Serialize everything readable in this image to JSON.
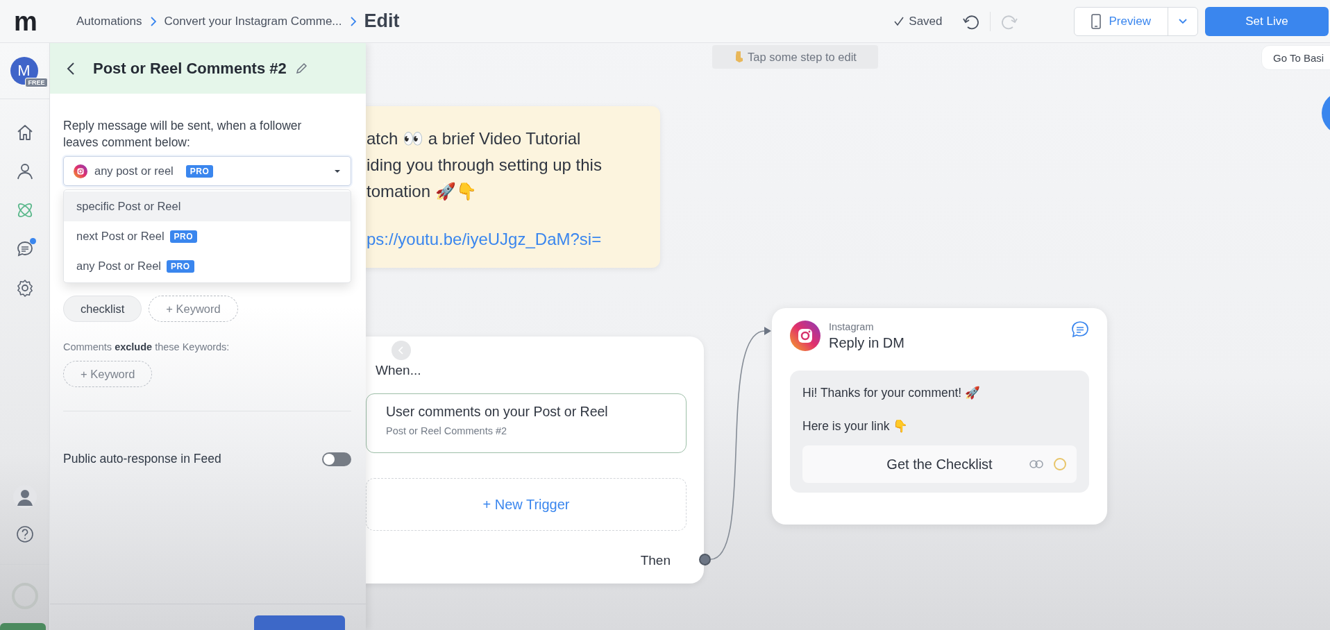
{
  "topbar": {
    "logo": "m",
    "breadcrumbs": [
      {
        "label": "Automations"
      },
      {
        "label": "Convert your Instagram Comme..."
      }
    ],
    "current": "Edit",
    "saved": "Saved",
    "redo_disabled": true,
    "preview": "Preview",
    "set_live": "Set Live"
  },
  "rail": {
    "avatar_letter": "M",
    "plan": "FREE",
    "items": [
      {
        "selected": false,
        "notification": false
      },
      {
        "selected": false,
        "notification": false
      },
      {
        "selected": true,
        "notification": false
      },
      {
        "selected": false,
        "notification": true
      },
      {
        "selected": false,
        "notification": false
      }
    ]
  },
  "panel": {
    "title": "Post or Reel Comments #2",
    "intro": "Reply message will be sent, when a follower leaves comment below:",
    "select": {
      "value": "any post or reel",
      "badge": "PRO",
      "open": true
    },
    "options": [
      {
        "label": "specific Post or Reel",
        "hovered": true
      },
      {
        "label": "next Post or Reel",
        "badge": "PRO",
        "hovered": false
      },
      {
        "label": "any Post or Reel",
        "badge": "PRO",
        "hovered": false
      }
    ],
    "include_keywords": [
      {
        "label": "checklist",
        "kind": "chip"
      },
      {
        "label": "+ Keyword",
        "kind": "add"
      }
    ],
    "exclude_label": "Comments **exclude** these Keywords:",
    "exclude_keywords": [
      {
        "label": "+ Keyword",
        "kind": "add"
      }
    ],
    "public_response": {
      "label": "Public auto-response in Feed",
      "on": false
    }
  },
  "canvas": {
    "hint": "Tap some step to edit",
    "basic_button": "Go To Basi",
    "note": {
      "lines": [
        "atch 👀 a brief Video Tutorial",
        "iding you through setting up this",
        "tomation 🚀👇"
      ],
      "link": "ps://youtu.be/iyeUJgz_DaM?si="
    },
    "trigger_card": {
      "heading": "When...",
      "trigger": {
        "title": "User comments on your Post or Reel",
        "subtitle": "Post or Reel Comments #2"
      },
      "new_trigger": "+ New Trigger",
      "then": "Then"
    },
    "reply_node": {
      "channel": "Instagram",
      "title": "Reply in DM",
      "messages": [
        "Hi! Thanks for your comment! 🚀",
        "Here is your link 👇"
      ],
      "button": "Get the Checklist"
    }
  }
}
